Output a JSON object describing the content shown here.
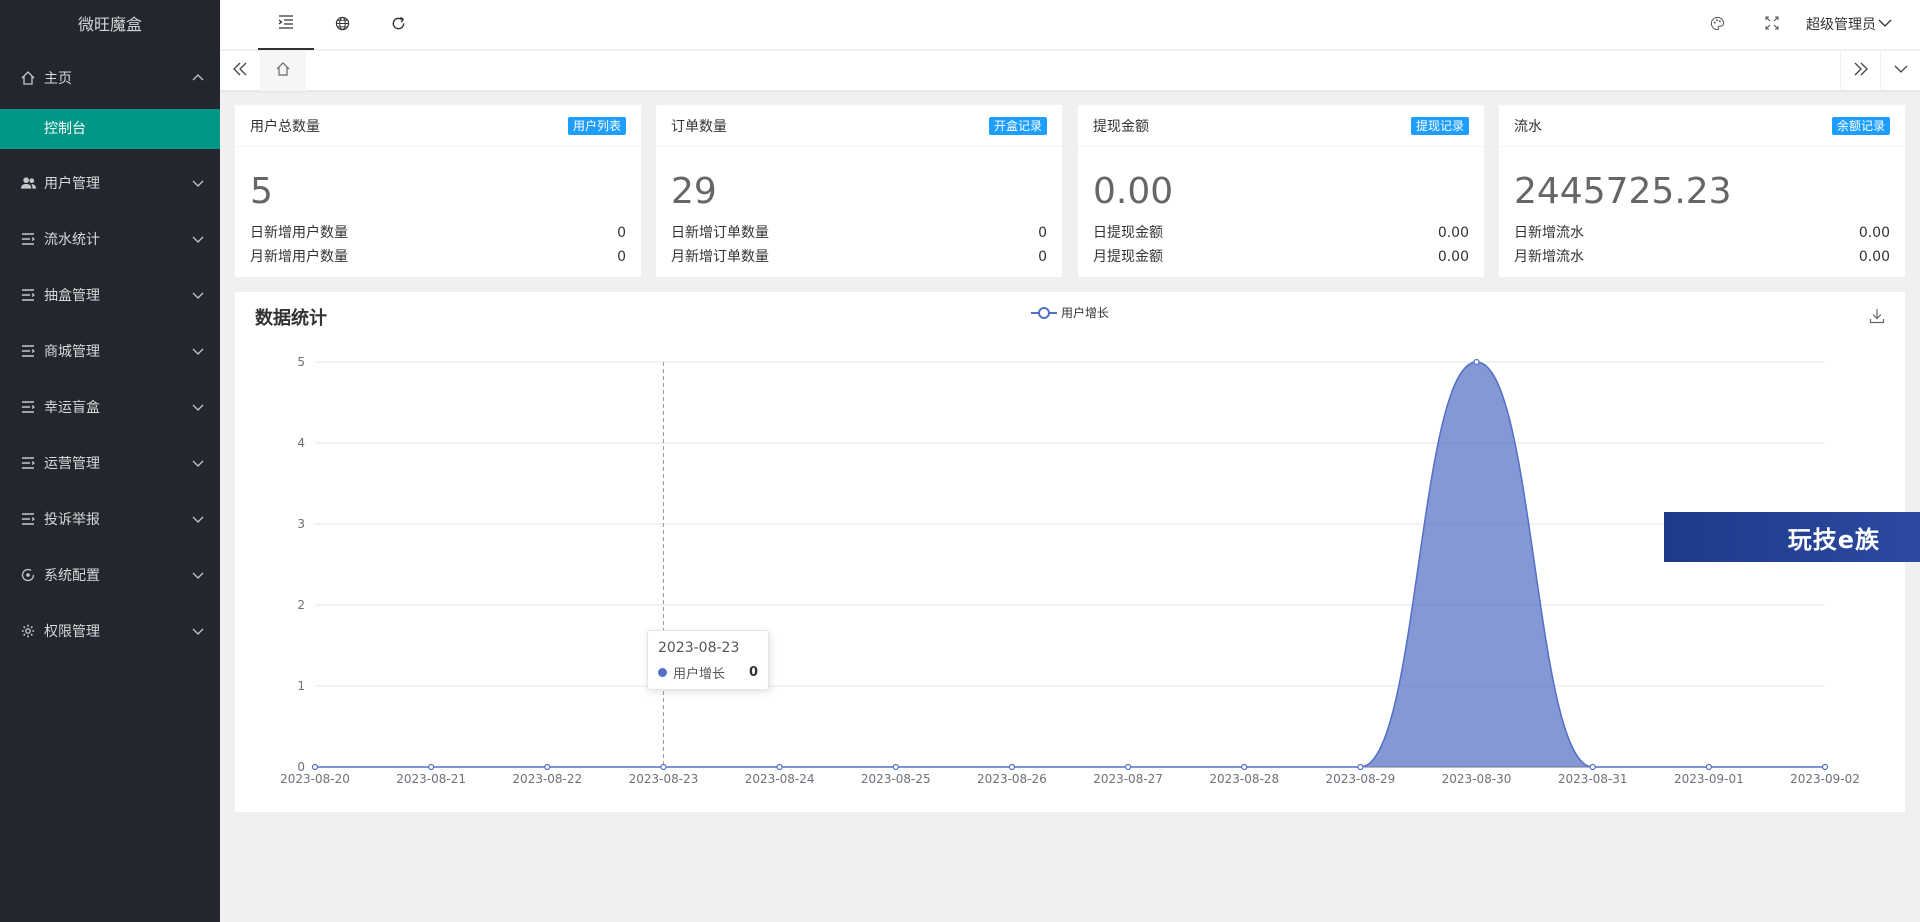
{
  "app": {
    "title": "微旺魔盒"
  },
  "sidebar": {
    "home": {
      "label": "主页",
      "icon": "home-icon"
    },
    "sub_items": [
      {
        "label": "控制台"
      }
    ],
    "items": [
      {
        "label": "用户管理",
        "icon": "users-icon"
      },
      {
        "label": "流水统计",
        "icon": "list-icon"
      },
      {
        "label": "抽盒管理",
        "icon": "list-icon"
      },
      {
        "label": "商城管理",
        "icon": "list-icon"
      },
      {
        "label": "幸运盲盒",
        "icon": "list-icon"
      },
      {
        "label": "运营管理",
        "icon": "list-icon"
      },
      {
        "label": "投诉举报",
        "icon": "list-icon"
      },
      {
        "label": "系统配置",
        "icon": "settings-icon"
      },
      {
        "label": "权限管理",
        "icon": "gear-icon"
      }
    ]
  },
  "topbar": {
    "user_label": "超级管理员"
  },
  "cards": [
    {
      "title": "用户总数量",
      "badge": "用户列表",
      "value": "5",
      "rows": [
        {
          "label": "日新增用户数量",
          "value": "0"
        },
        {
          "label": "月新增用户数量",
          "value": "0"
        }
      ]
    },
    {
      "title": "订单数量",
      "badge": "开盒记录",
      "value": "29",
      "rows": [
        {
          "label": "日新增订单数量",
          "value": "0"
        },
        {
          "label": "月新增订单数量",
          "value": "0"
        }
      ]
    },
    {
      "title": "提现金额",
      "badge": "提现记录",
      "value": "0.00",
      "rows": [
        {
          "label": "日提现金额",
          "value": "0.00"
        },
        {
          "label": "月提现金额",
          "value": "0.00"
        }
      ]
    },
    {
      "title": "流水",
      "badge": "余额记录",
      "value": "2445725.23",
      "rows": [
        {
          "label": "日新增流水",
          "value": "0.00"
        },
        {
          "label": "月新增流水",
          "value": "0.00"
        }
      ]
    }
  ],
  "panel": {
    "title": "数据统计"
  },
  "chart_data": {
    "type": "area",
    "x": [
      "2023-08-20",
      "2023-08-21",
      "2023-08-22",
      "2023-08-23",
      "2023-08-24",
      "2023-08-25",
      "2023-08-26",
      "2023-08-27",
      "2023-08-28",
      "2023-08-29",
      "2023-08-30",
      "2023-08-31",
      "2023-09-01",
      "2023-09-02"
    ],
    "series": [
      {
        "name": "用户增长",
        "values": [
          0,
          0,
          0,
          0,
          0,
          0,
          0,
          0,
          0,
          0,
          5,
          0,
          0,
          0
        ],
        "color": "#5470c6"
      }
    ],
    "ylim": [
      0,
      5
    ],
    "yticks": [
      0,
      1,
      2,
      3,
      4,
      5
    ],
    "grid": true,
    "legend": "top-center",
    "smooth": true
  },
  "tooltip": {
    "date": "2023-08-23",
    "series": "用户增长",
    "value": "0"
  },
  "watermark": {
    "text": "玩技e族"
  }
}
